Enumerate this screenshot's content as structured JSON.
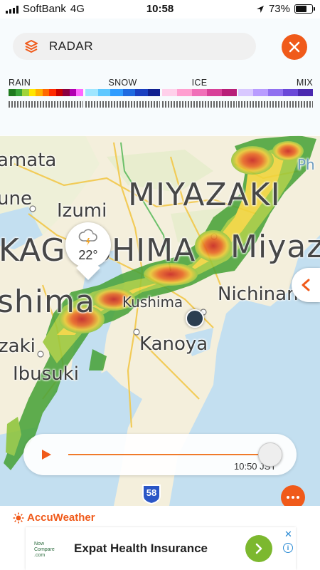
{
  "status_bar": {
    "carrier": "SoftBank",
    "network": "4G",
    "time": "10:58",
    "battery": "73%",
    "battery_level": 0.73
  },
  "header": {
    "title": "RADAR"
  },
  "legend": [
    {
      "label": "RAIN",
      "colors": [
        "#1f7a1f",
        "#3aa63a",
        "#9fd43a",
        "#ffe600",
        "#ffb000",
        "#ff6a00",
        "#ff2a00",
        "#c80000",
        "#8b0040",
        "#b000b0",
        "#ff66ff"
      ]
    },
    {
      "label": "SNOW",
      "colors": [
        "#9fe6ff",
        "#5fc8ff",
        "#2f9cff",
        "#1f6ae0",
        "#1a3fc0",
        "#102090"
      ]
    },
    {
      "label": "ICE",
      "colors": [
        "#ffd0ea",
        "#ff9fd0",
        "#f070b8",
        "#d84098",
        "#b81e78"
      ]
    },
    {
      "label": "MIX",
      "colors": [
        "#d8c8ff",
        "#b89cff",
        "#9070f0",
        "#6a48d8",
        "#4a28b0"
      ]
    }
  ],
  "map": {
    "places": [
      {
        "name": "amata",
        "cls": "med"
      },
      {
        "name": "Izumi",
        "cls": "med"
      },
      {
        "name": "une",
        "cls": "med"
      },
      {
        "name": "MIYAZAKI",
        "cls": "big"
      },
      {
        "name": "KAGOSHIMA",
        "cls": "big"
      },
      {
        "name": "Miyaza",
        "cls": "big"
      },
      {
        "name": "shima",
        "cls": "big"
      },
      {
        "name": "Kushima",
        "cls": "sml"
      },
      {
        "name": "Nichinan",
        "cls": "med"
      },
      {
        "name": "Kanoya",
        "cls": "med"
      },
      {
        "name": "zaki",
        "cls": "med"
      },
      {
        "name": "Ibusuki",
        "cls": "med"
      },
      {
        "name": "Ph",
        "cls": "sml"
      }
    ],
    "route_number": "58",
    "current_temp": "22°"
  },
  "player": {
    "time_label": "10:50 JST"
  },
  "footer": {
    "brand": "AccuWeather",
    "ad_logo": "Now Compare .com",
    "ad_title": "Expat Health Insurance"
  }
}
